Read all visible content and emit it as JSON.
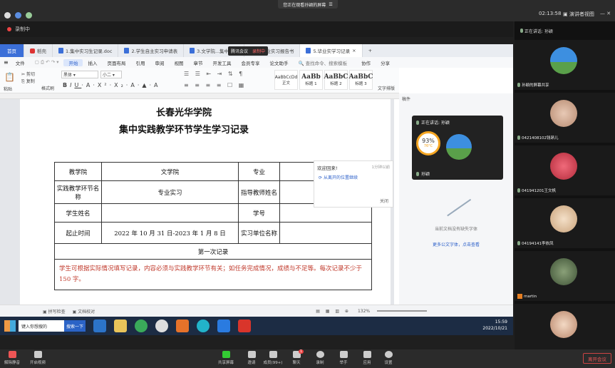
{
  "topbar": {
    "share_banner": "您正在观看孙颖的屏幕",
    "clock": "02:13:58",
    "gallery_btn": "演讲者视图",
    "recording": "录制中"
  },
  "tabs": [
    {
      "label": "首页"
    },
    {
      "label": "稻壳"
    },
    {
      "label": "1.集中实习生记录.doc"
    },
    {
      "label": "2.学生自主实习申请表"
    },
    {
      "label": "3.文学院...集中实..."
    },
    {
      "label": "4.毕业实习报告书"
    },
    {
      "label": "5.毕业实学习记录"
    }
  ],
  "overlay_tags": {
    "a": "腾讯会议",
    "b": "录制中"
  },
  "menu": [
    "文件",
    "开始",
    "插入",
    "页面布局",
    "引用",
    "审阅",
    "视图",
    "章节",
    "开发工具",
    "会员专享",
    "论文助手"
  ],
  "menu_right": {
    "search": "查找命令、搜索模板",
    "collab": "协作",
    "share": "分享"
  },
  "ribbon": {
    "cut": "剪切",
    "paste": "粘贴",
    "copy": "复制",
    "format_painter": "格式刷",
    "font": "黑体",
    "size": "小二",
    "styles": [
      {
        "preview": "AaBbCcDd",
        "name": "正文"
      },
      {
        "preview": "AaBb",
        "name": "标题 1"
      },
      {
        "preview": "AaBbC",
        "name": "标题 2"
      },
      {
        "preview": "AaBbC",
        "name": "标题 3"
      }
    ],
    "text_layout": "文字排版"
  },
  "document": {
    "title1": "长春光华学院",
    "title2": "集中实践教学环节学生学习记录",
    "table": {
      "r1": [
        "教学院",
        "文学院",
        "专业",
        ""
      ],
      "r2": [
        "实践教学环节名称",
        "专业实习",
        "指导教师姓名",
        ""
      ],
      "r3": [
        "学生姓名",
        "",
        "学号",
        ""
      ],
      "r4": [
        "起止时间",
        "2022 年 10 月 31 日-2023 年 1 月 8 日",
        "实习单位名称",
        ""
      ],
      "section": "第一次记录",
      "note": "学生可根据实际情况填写记录，内容必须与实践教学环节有关；如任务完成情况，成绩与不足等。每次记录不少于 150 字。"
    }
  },
  "welcome": {
    "title": "欢迎回来!",
    "time": "1分钟以前",
    "link": "从离开的位置继续",
    "close": "关闭"
  },
  "side_panel": {
    "header": "稿件",
    "empty": "当前文档没有缺失字体",
    "more": "更多公文字体，点击查看"
  },
  "speaking": {
    "label": "正在讲话: 孙颖",
    "percent": "93%",
    "temp": "76°C",
    "name": "孙颖"
  },
  "statusbar": {
    "spell": "拼写检查",
    "align": "文档校对",
    "zoom": "132%",
    "clip": "你的声..."
  },
  "taskbar": {
    "search": "键入你想搜的",
    "search_btn": "搜索一下",
    "time": "15:59",
    "date": "2022/10/21"
  },
  "gallery": {
    "header": "正在讲话: 孙颖",
    "tiles": [
      {
        "name": "孙颖的屏幕共享"
      },
      {
        "name": "0421408102钱昂儿"
      },
      {
        "name": "041941201王文帆"
      },
      {
        "name": "04194141李依凤"
      },
      {
        "name": "martin"
      },
      {
        "name": ""
      }
    ]
  },
  "meetbar": {
    "mute": "解除静音",
    "video": "开启视频",
    "center": [
      "共享屏幕",
      "邀请",
      "成员(99+)",
      "聊天",
      "录制",
      "举手",
      "应用",
      "设置"
    ],
    "leave": "离开会议",
    "chat_badge": "1"
  }
}
